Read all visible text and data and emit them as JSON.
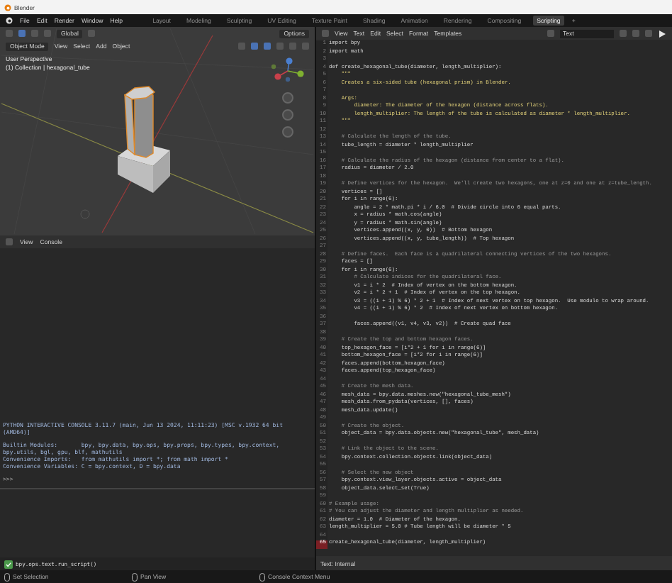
{
  "window": {
    "title": "Blender"
  },
  "menu": [
    "File",
    "Edit",
    "Render",
    "Window",
    "Help"
  ],
  "workspaces": [
    {
      "label": "Layout",
      "selected": false
    },
    {
      "label": "Modeling",
      "selected": false
    },
    {
      "label": "Sculpting",
      "selected": false
    },
    {
      "label": "UV Editing",
      "selected": false
    },
    {
      "label": "Texture Paint",
      "selected": false
    },
    {
      "label": "Shading",
      "selected": false
    },
    {
      "label": "Animation",
      "selected": false
    },
    {
      "label": "Rendering",
      "selected": false
    },
    {
      "label": "Compositing",
      "selected": false
    },
    {
      "label": "Scripting",
      "selected": true
    }
  ],
  "add_workspace": "+",
  "viewport": {
    "transform": "Global",
    "options": "Options",
    "mode": "Object Mode",
    "menus": [
      "View",
      "Select",
      "Add",
      "Object"
    ],
    "overlay_lines": [
      "User Perspective",
      "(1) Collection | hexagonal_tube"
    ]
  },
  "console": {
    "menus": [
      "View",
      "Console"
    ],
    "lines": [
      "PYTHON INTERACTIVE CONSOLE 3.11.7 (main, Jun 13 2024, 11:11:23) [MSC v.1932 64 bit (AMD64)]",
      "Builtin Modules:       bpy, bpy.data, bpy.ops, bpy.props, bpy.types, bpy.context, bpy.utils, bgl, gpu, blf, mathutils",
      "Convenience Imports:   from mathutils import *; from math import *",
      "Convenience Variables: C = bpy.context, D = bpy.data"
    ],
    "prompt": ">>>"
  },
  "report": "bpy.ops.text.run_script()",
  "text_editor": {
    "menus": [
      "View",
      "Text",
      "Edit",
      "Select",
      "Format",
      "Templates"
    ],
    "text_name": "Text",
    "footer": "Text: Internal",
    "lines": [
      {
        "n": "1",
        "code": "import bpy",
        "kind": "code",
        "selected": false
      },
      {
        "n": "2",
        "code": "import math",
        "kind": "code",
        "selected": false
      },
      {
        "n": "3",
        "selected": false
      },
      {
        "n": "4",
        "code": "def create_hexagonal_tube(diameter, length_multiplier):",
        "kind": "code",
        "selected": false
      },
      {
        "n": "5",
        "code": "    \"\"\"",
        "kind": "docstring",
        "selected": false
      },
      {
        "n": "6",
        "code": "    Creates a six-sided tube (hexagonal prism) in Blender.",
        "kind": "docstring",
        "selected": false
      },
      {
        "n": "7",
        "selected": false
      },
      {
        "n": "8",
        "code": "    Args:",
        "kind": "docstring",
        "selected": false
      },
      {
        "n": "9",
        "code": "        diameter: The diameter of the hexagon (distance across flats).",
        "kind": "docstring",
        "selected": false
      },
      {
        "n": "10",
        "code": "        length_multiplier: The length of the tube is calculated as diameter * length_multiplier.",
        "kind": "docstring",
        "selected": false
      },
      {
        "n": "11",
        "code": "    \"\"\"",
        "kind": "docstring",
        "selected": false
      },
      {
        "n": "12",
        "selected": false
      },
      {
        "n": "13",
        "code": "    # Calculate the length of the tube.",
        "kind": "comment",
        "selected": false
      },
      {
        "n": "14",
        "code": "    tube_length = diameter * length_multiplier",
        "kind": "code",
        "selected": false
      },
      {
        "n": "15",
        "selected": false
      },
      {
        "n": "16",
        "code": "    # Calculate the radius of the hexagon (distance from center to a flat).",
        "kind": "comment",
        "selected": false
      },
      {
        "n": "17",
        "code": "    radius = diameter / 2.0",
        "kind": "code",
        "selected": false
      },
      {
        "n": "18",
        "selected": false
      },
      {
        "n": "19",
        "code": "    # Define vertices for the hexagon.  We'll create two hexagons, one at z=0 and one at z=tube_length.",
        "kind": "comment",
        "selected": false
      },
      {
        "n": "20",
        "code": "    vertices = []",
        "kind": "code",
        "selected": false
      },
      {
        "n": "21",
        "code": "    for i in range(6):",
        "kind": "code",
        "selected": false
      },
      {
        "n": "22",
        "code": "        angle = 2 * math.pi * i / 6.0  # Divide circle into 6 equal parts.",
        "kind": "code",
        "selected": false
      },
      {
        "n": "23",
        "code": "        x = radius * math.cos(angle)",
        "kind": "code",
        "selected": false
      },
      {
        "n": "24",
        "code": "        y = radius * math.sin(angle)",
        "kind": "code",
        "selected": false
      },
      {
        "n": "25",
        "code": "        vertices.append((x, y, 0))  # Bottom hexagon",
        "kind": "code",
        "selected": false
      },
      {
        "n": "26",
        "code": "        vertices.append((x, y, tube_length))  # Top hexagon",
        "kind": "code",
        "selected": false
      },
      {
        "n": "27",
        "selected": false
      },
      {
        "n": "28",
        "code": "    # Define faces.  Each face is a quadrilateral connecting vertices of the two hexagons.",
        "kind": "comment",
        "selected": false
      },
      {
        "n": "29",
        "code": "    faces = []",
        "kind": "code",
        "selected": false
      },
      {
        "n": "30",
        "code": "    for i in range(6):",
        "kind": "code",
        "selected": false
      },
      {
        "n": "31",
        "code": "        # Calculate indices for the quadrilateral face.",
        "kind": "comment",
        "selected": false
      },
      {
        "n": "32",
        "code": "        v1 = i * 2  # Index of vertex on the bottom hexagon.",
        "kind": "code",
        "selected": false
      },
      {
        "n": "33",
        "code": "        v2 = i * 2 + 1  # Index of vertex on the top hexagon.",
        "kind": "code",
        "selected": false
      },
      {
        "n": "34",
        "code": "        v3 = ((i + 1) % 6) * 2 + 1  # Index of next vertex on top hexagon.  Use modulo to wrap around.",
        "kind": "code",
        "selected": false
      },
      {
        "n": "35",
        "code": "        v4 = ((i + 1) % 6) * 2  # Index of next vertex on bottom hexagon.",
        "kind": "code",
        "selected": false
      },
      {
        "n": "36",
        "selected": false
      },
      {
        "n": "37",
        "code": "        faces.append((v1, v4, v3, v2))  # Create quad face",
        "kind": "code",
        "selected": false
      },
      {
        "n": "38",
        "selected": false
      },
      {
        "n": "39",
        "code": "    # Create the top and bottom hexagon faces.",
        "kind": "comment",
        "selected": false
      },
      {
        "n": "40",
        "code": "    top_hexagon_face = [i*2 + 1 for i in range(6)]",
        "kind": "code",
        "selected": false
      },
      {
        "n": "41",
        "code": "    bottom_hexagon_face = [i*2 for i in range(6)]",
        "kind": "code",
        "selected": false
      },
      {
        "n": "42",
        "code": "    faces.append(bottom_hexagon_face)",
        "kind": "code",
        "selected": false
      },
      {
        "n": "43",
        "code": "    faces.append(top_hexagon_face)",
        "kind": "code",
        "selected": false
      },
      {
        "n": "44",
        "selected": false
      },
      {
        "n": "45",
        "code": "    # Create the mesh data.",
        "kind": "comment",
        "selected": false
      },
      {
        "n": "46",
        "code": "    mesh_data = bpy.data.meshes.new(\"hexagonal_tube_mesh\")",
        "kind": "code",
        "selected": false
      },
      {
        "n": "47",
        "code": "    mesh_data.from_pydata(vertices, [], faces)",
        "kind": "code",
        "selected": false
      },
      {
        "n": "48",
        "code": "    mesh_data.update()",
        "kind": "code",
        "selected": false
      },
      {
        "n": "49",
        "selected": false
      },
      {
        "n": "50",
        "code": "    # Create the object.",
        "kind": "comment",
        "selected": false
      },
      {
        "n": "51",
        "code": "    object_data = bpy.data.objects.new(\"hexagonal_tube\", mesh_data)",
        "kind": "code",
        "selected": false
      },
      {
        "n": "52",
        "selected": false
      },
      {
        "n": "53",
        "code": "    # Link the object to the scene.",
        "kind": "comment",
        "selected": false
      },
      {
        "n": "54",
        "code": "    bpy.context.collection.objects.link(object_data)",
        "kind": "code",
        "selected": false
      },
      {
        "n": "55",
        "selected": false
      },
      {
        "n": "56",
        "code": "    # Select the new object",
        "kind": "comment",
        "selected": false
      },
      {
        "n": "57",
        "code": "    bpy.context.view_layer.objects.active = object_data",
        "kind": "code",
        "selected": false
      },
      {
        "n": "58",
        "code": "    object_data.select_set(True)",
        "kind": "code",
        "selected": false
      },
      {
        "n": "59",
        "selected": false
      },
      {
        "n": "60",
        "code": "# Example usage:",
        "kind": "comment",
        "selected": false
      },
      {
        "n": "61",
        "code": "# You can adjust the diameter and length multiplier as needed.",
        "kind": "comment",
        "selected": false
      },
      {
        "n": "62",
        "code": "diameter = 1.0  # Diameter of the hexagon.",
        "kind": "code",
        "selected": false
      },
      {
        "n": "63",
        "code": "length_multiplier = 5.0 # Tube length will be diameter * 5",
        "kind": "code",
        "selected": false
      },
      {
        "n": "64",
        "selected": false
      },
      {
        "n": "65",
        "code": "create_hexagonal_tube(diameter, length_multiplier)",
        "kind": "code",
        "selected": true
      }
    ]
  },
  "status_bar": [
    "Set Selection",
    "Pan View",
    "Console Context Menu"
  ]
}
